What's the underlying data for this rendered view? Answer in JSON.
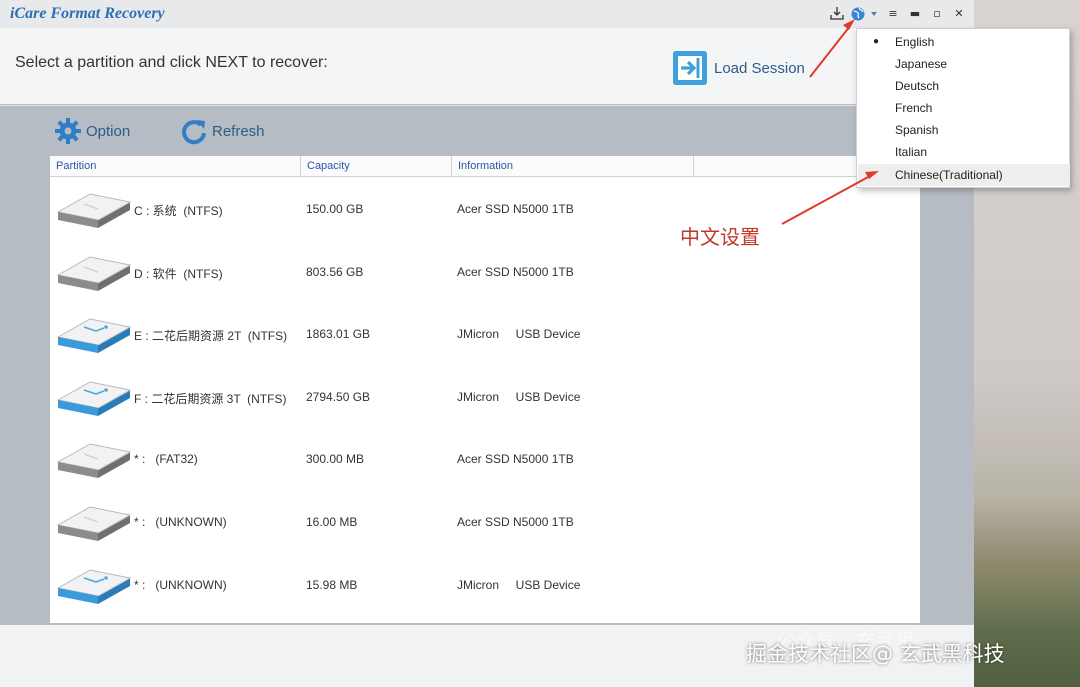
{
  "app": {
    "title": "iCare Format Recovery",
    "instruction": "Select a partition and click NEXT to recover:",
    "load_session_label": "Load Session"
  },
  "titlebar_buttons": [
    "download-icon",
    "globe-icon",
    "menu-icon",
    "minimize-icon",
    "maximize-icon",
    "close-icon"
  ],
  "toolbar": {
    "option_label": "Option",
    "refresh_label": "Refresh"
  },
  "table": {
    "columns": [
      "Partition",
      "Capacity",
      "Information"
    ],
    "rows": [
      {
        "partition": "C : 系统  (NTFS)",
        "capacity": "150.00 GB",
        "info": "Acer SSD N5000 1TB",
        "drive_type": "hdd"
      },
      {
        "partition": "D : 软件  (NTFS)",
        "capacity": "803.56 GB",
        "info": "Acer SSD N5000 1TB",
        "drive_type": "hdd"
      },
      {
        "partition": "E : 二花后期资源 2T  (NTFS)",
        "capacity": "1863.01 GB",
        "info": "JMicron     USB Device",
        "drive_type": "usb"
      },
      {
        "partition": "F : 二花后期资源 3T  (NTFS)",
        "capacity": "2794.50 GB",
        "info": "JMicron     USB Device",
        "drive_type": "usb"
      },
      {
        "partition": "* :   (FAT32)",
        "capacity": "300.00 MB",
        "info": "Acer SSD N5000 1TB",
        "drive_type": "hdd"
      },
      {
        "partition": "* :   (UNKNOWN)",
        "capacity": "16.00 MB",
        "info": "Acer SSD N5000 1TB",
        "drive_type": "hdd"
      },
      {
        "partition": "* :   (UNKNOWN)",
        "capacity": "15.98 MB",
        "info": "JMicron     USB Device",
        "drive_type": "usb"
      }
    ]
  },
  "language_menu": {
    "items": [
      "English",
      "Japanese",
      "Deutsch",
      "French",
      "Spanish",
      "Italian",
      "Chinese(Traditional)"
    ],
    "selected": "English",
    "highlighted": "Chinese(Traditional)"
  },
  "annotation": {
    "text": "中文设置",
    "color": "#c0392b"
  },
  "watermark": {
    "faint": "公众号 · 玄武黑",
    "text": "掘金技术社区@ 玄武黑科技"
  },
  "colors": {
    "accent": "#2a6fb8",
    "usb_drive": "#3b9ad9",
    "annotation_red": "#e03a2b"
  }
}
